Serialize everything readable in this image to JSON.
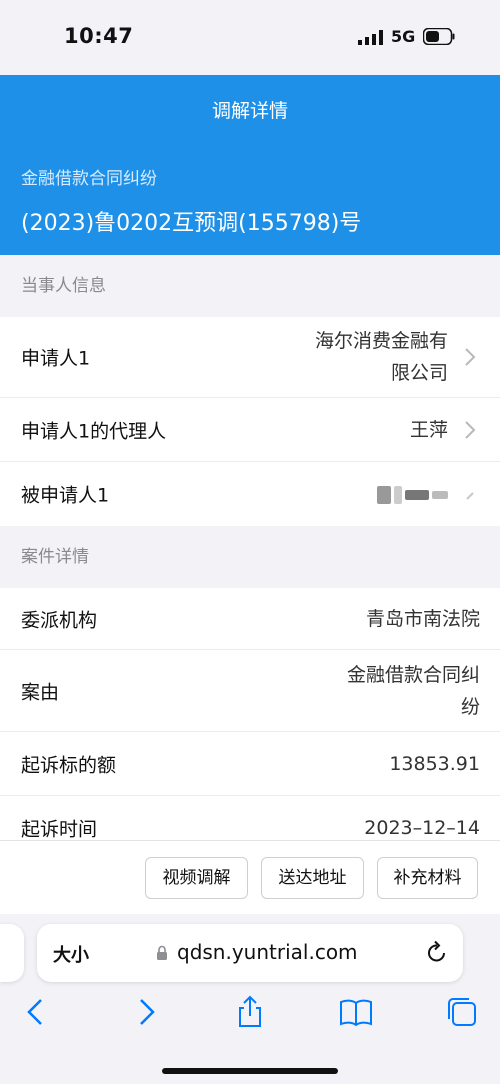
{
  "status_bar": {
    "time": "10:47",
    "network": "5G"
  },
  "header": {
    "title": "调解详情",
    "case_type": "金融借款合同纠纷",
    "case_number": "(2023)鲁0202互预调(155798)号"
  },
  "parties": {
    "section_title": "当事人信息",
    "rows": [
      {
        "label": "申请人1",
        "value_line1": "海尔消费金融有",
        "value_line2": "限公司"
      },
      {
        "label": "申请人1的代理人",
        "value": "王萍"
      },
      {
        "label": "被申请人1"
      }
    ]
  },
  "case_details": {
    "section_title": "案件详情",
    "rows": [
      {
        "label": "委派机构",
        "value": "青岛市南法院"
      },
      {
        "label": "案由",
        "value_line1": "金融借款合同纠",
        "value_line2": "纷"
      },
      {
        "label": "起诉标的额",
        "value": "13853.91"
      },
      {
        "label": "起诉时间",
        "value": "2023–12–14"
      }
    ]
  },
  "actions": {
    "video": "视频调解",
    "address": "送达地址",
    "materials": "补充材料"
  },
  "browser": {
    "text_size": "大小",
    "url": "qdsn.yuntrial.com"
  },
  "colors": {
    "header_bg": "#1e90e8",
    "accent": "#007aff"
  },
  "icons": [
    "signal-icon",
    "battery-icon",
    "chevron-right-icon",
    "lock-icon",
    "reload-icon",
    "back-icon",
    "forward-icon",
    "share-icon",
    "bookmarks-icon",
    "tabs-icon"
  ]
}
